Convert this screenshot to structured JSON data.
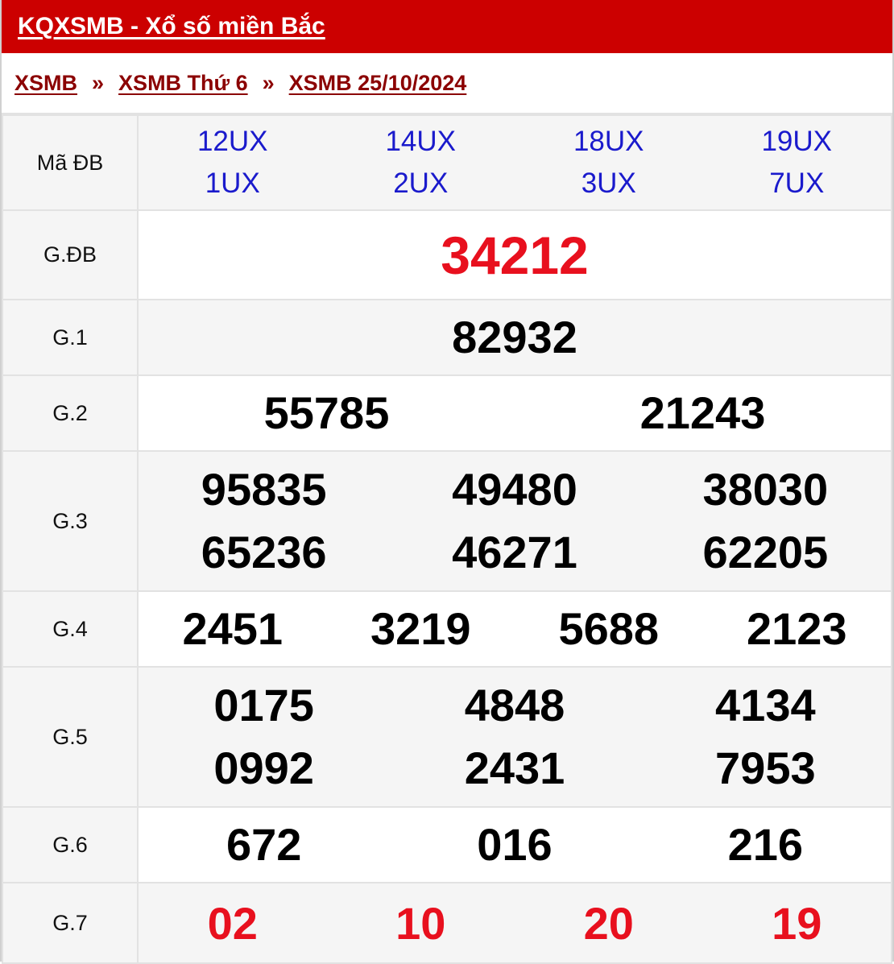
{
  "header": {
    "title": "KQXSMB - Xổ số miền Bắc"
  },
  "breadcrumb": {
    "items": [
      "XSMB",
      "XSMB Thứ 6",
      "XSMB 25/10/2024"
    ],
    "separator": "»"
  },
  "ma_db": {
    "label": "Mã ĐB",
    "codes": [
      [
        "12UX",
        "1UX"
      ],
      [
        "14UX",
        "2UX"
      ],
      [
        "18UX",
        "3UX"
      ],
      [
        "19UX",
        "7UX"
      ]
    ]
  },
  "prizes": {
    "gdb": {
      "label": "G.ĐB",
      "numbers": [
        "34212"
      ]
    },
    "g1": {
      "label": "G.1",
      "numbers": [
        "82932"
      ]
    },
    "g2": {
      "label": "G.2",
      "numbers": [
        "55785",
        "21243"
      ]
    },
    "g3": {
      "label": "G.3",
      "numbers": [
        "95835",
        "49480",
        "38030",
        "65236",
        "46271",
        "62205"
      ]
    },
    "g4": {
      "label": "G.4",
      "numbers": [
        "2451",
        "3219",
        "5688",
        "2123"
      ]
    },
    "g5": {
      "label": "G.5",
      "numbers": [
        "0175",
        "4848",
        "4134",
        "0992",
        "2431",
        "7953"
      ]
    },
    "g6": {
      "label": "G.6",
      "numbers": [
        "672",
        "016",
        "216"
      ]
    },
    "g7": {
      "label": "G.7",
      "numbers": [
        "02",
        "10",
        "20",
        "19"
      ]
    }
  },
  "colors": {
    "header_bg": "#cc0000",
    "breadcrumb_link": "#8b0000",
    "code_text": "#1a1acc",
    "highlight_number": "#e8101e"
  }
}
